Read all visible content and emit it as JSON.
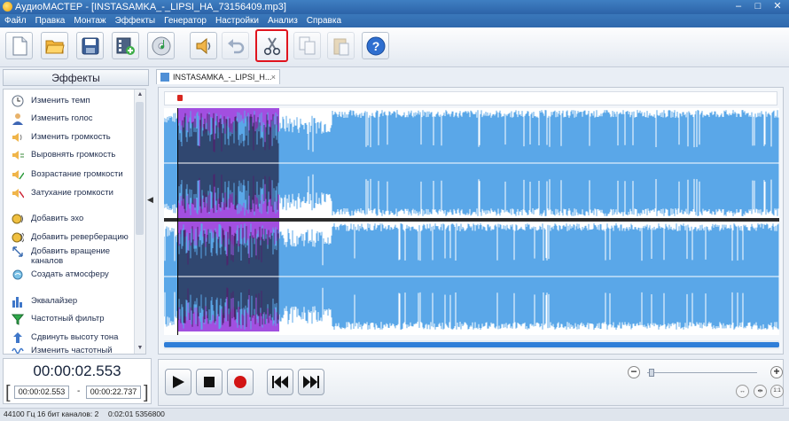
{
  "window": {
    "title": "АудиоМАСТЕР - [INSTASAMKA_-_LIPSI_HA_73156409.mp3]",
    "minimize_glyph": "–",
    "maximize_glyph": "□",
    "close_glyph": "✕"
  },
  "menu": [
    "Файл",
    "Правка",
    "Монтаж",
    "Эффекты",
    "Генератор",
    "Настройки",
    "Анализ",
    "Справка"
  ],
  "toolbar": {
    "buttons": [
      {
        "icon": "new-file-icon"
      },
      {
        "icon": "open-folder-icon"
      },
      {
        "icon": "save-icon"
      },
      {
        "icon": "add-video-icon"
      },
      {
        "icon": "cd-icon"
      },
      {
        "icon": "speaker-icon"
      },
      {
        "icon": "undo-icon"
      },
      {
        "icon": "scissors-icon",
        "highlighted": true,
        "highlight_color": "#e0141e"
      },
      {
        "icon": "copy-icon"
      },
      {
        "icon": "paste-icon"
      },
      {
        "icon": "help-icon"
      }
    ]
  },
  "effects_panel": {
    "header": "Эффекты",
    "items": [
      {
        "label": "Изменить темп",
        "icon": "clock-icon"
      },
      {
        "label": "Изменить голос",
        "icon": "person-icon"
      },
      {
        "label": "Изменить громкость",
        "icon": "volume-icon"
      },
      {
        "label": "Выровнять громкость",
        "icon": "volume-level-icon"
      },
      {
        "label": "Возрастание громкости",
        "icon": "fade-in-icon"
      },
      {
        "label": "Затухание громкости",
        "icon": "fade-out-icon"
      },
      {
        "label": "Добавить эхо",
        "icon": "echo-icon"
      },
      {
        "label": "Добавить реверберацию",
        "icon": "reverb-icon"
      },
      {
        "label": "Добавить вращение каналов",
        "icon": "rotate-channels-icon"
      },
      {
        "label": "Создать атмосферу",
        "icon": "atmosphere-icon"
      },
      {
        "label": "Эквалайзер",
        "icon": "equalizer-icon"
      },
      {
        "label": "Частотный фильтр",
        "icon": "filter-icon"
      },
      {
        "label": "Сдвинуть высоту тона",
        "icon": "pitch-icon"
      },
      {
        "label": "Изменить частотный",
        "icon": "frequency-icon"
      }
    ]
  },
  "time": {
    "current": "00:00:02.553",
    "selection_start": "00:00:02.553",
    "selection_end": "00:00:22.737",
    "separator": "-"
  },
  "document_tab": {
    "label": "INSTASAMKA_-_LIPSI_H...",
    "close": "×"
  },
  "waveform": {
    "channels": 2,
    "selection_color": "#a24fe0",
    "wave_color": "#5aa7e8"
  },
  "transport": {
    "buttons": [
      "play-icon",
      "stop-icon",
      "record-icon",
      "rewind-icon",
      "fast-forward-icon"
    ],
    "zoom_minus": "−",
    "zoom_plus": "+"
  },
  "status": {
    "format": "44100 Гц  16 бит  каналов: 2",
    "duration": "0:02:01  5356800"
  }
}
